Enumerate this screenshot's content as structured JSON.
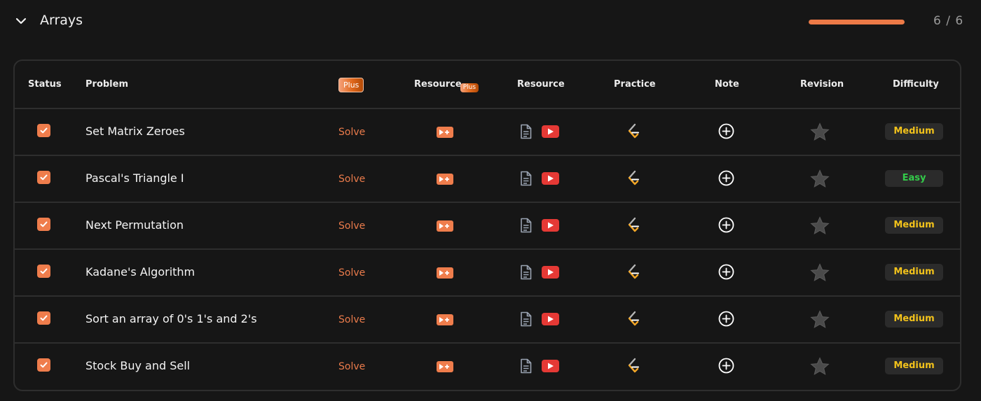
{
  "section": {
    "title": "Arrays",
    "progress_text": "6 / 6",
    "progress_fraction": 1.0,
    "accent": "#ed7a47"
  },
  "columns": {
    "status": "Status",
    "problem": "Problem",
    "plus_badge": "Plus",
    "resource_plus": "Resource",
    "resource_plus_badge": "Plus",
    "resource": "Resource",
    "practice": "Practice",
    "note": "Note",
    "revision": "Revision",
    "difficulty": "Difficulty"
  },
  "solve_label": "Solve",
  "difficulty_colors": {
    "Medium": "#f2c21b",
    "Easy": "#33cc4a"
  },
  "problems": [
    {
      "name": "Set Matrix Zeroes",
      "difficulty": "Medium",
      "done": true
    },
    {
      "name": "Pascal's Triangle I",
      "difficulty": "Easy",
      "done": true
    },
    {
      "name": "Next Permutation",
      "difficulty": "Medium",
      "done": true
    },
    {
      "name": "Kadane's Algorithm",
      "difficulty": "Medium",
      "done": true
    },
    {
      "name": "Sort an array of 0's 1's and 2's",
      "difficulty": "Medium",
      "done": true
    },
    {
      "name": "Stock Buy and Sell",
      "difficulty": "Medium",
      "done": true
    }
  ],
  "icons": {
    "collapse": "chevron-down-icon",
    "status": "checkbox-checked-icon",
    "plus_resource": "plus-video-icon",
    "article": "document-icon",
    "video": "youtube-icon",
    "practice": "practice-platform-icon",
    "note": "add-note-icon",
    "revision": "star-icon"
  }
}
